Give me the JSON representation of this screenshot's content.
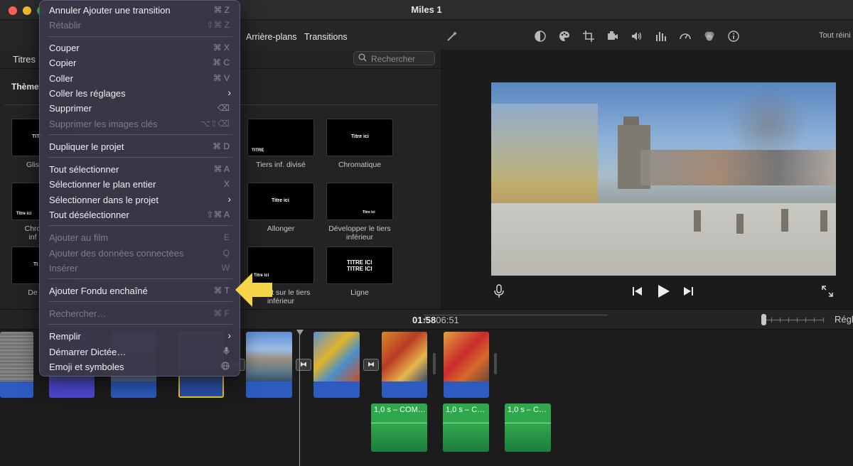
{
  "window": {
    "title": "Miles 1"
  },
  "toolbar": {
    "tabs": [
      "Arrière-plans",
      "Transitions"
    ],
    "reset_label": "Tout réini",
    "icons": [
      "magic-wand-icon",
      "color-balance-icon",
      "color-palette-icon",
      "crop-icon",
      "camera-icon",
      "volume-icon",
      "equalizer-icon",
      "speed-icon",
      "filter-icon",
      "info-icon"
    ]
  },
  "browser": {
    "tab": "Titres",
    "search_placeholder": "Rechercher",
    "themes_label": "Thème",
    "thumbnails": [
      {
        "thumb_text": "TITR",
        "label": "Glis"
      },
      {
        "thumb_text": "TITRE",
        "label": "Tiers inf. divisé"
      },
      {
        "thumb_text": "Titre ici",
        "label": "Chromatique"
      },
      {
        "thumb_text": "Titre ici",
        "label": "Chro\ninf"
      },
      {
        "thumb_text": "Titre ici",
        "label": "Allonger"
      },
      {
        "thumb_text": "Titre ici",
        "label": "Développer le tiers inférieur"
      },
      {
        "thumb_text": "TI",
        "label": "De"
      },
      {
        "thumb_text": "Titre ici",
        "label": "u point sur le tiers inférieur"
      },
      {
        "thumb_text": "TITRE ICI\nTITRE ICI",
        "label": "Ligne"
      }
    ]
  },
  "timeline": {
    "current_time": "01:58",
    "total_time": "06:51",
    "settings_label": "Régl",
    "audio_clips": [
      "1,0 s – COM…",
      "1,0 s – C…",
      "1,0 s – C…"
    ]
  },
  "menu": {
    "items": [
      {
        "label": "Annuler Ajouter une transition",
        "shortcut": "⌘ Z",
        "disabled": false
      },
      {
        "label": "Rétablir",
        "shortcut": "⇧⌘ Z",
        "disabled": true
      },
      {
        "label": "Couper",
        "shortcut": "⌘ X",
        "disabled": false
      },
      {
        "label": "Copier",
        "shortcut": "⌘ C",
        "disabled": false
      },
      {
        "label": "Coller",
        "shortcut": "⌘ V",
        "disabled": false
      },
      {
        "label": "Coller les réglages",
        "shortcut": "",
        "disabled": false
      },
      {
        "label": "Supprimer",
        "shortcut": "⌫",
        "disabled": false
      },
      {
        "label": "Supprimer les images clés",
        "shortcut": "⌥⇧⌫",
        "disabled": true
      },
      {
        "label": "Dupliquer le projet",
        "shortcut": "⌘ D",
        "disabled": false
      },
      {
        "label": "Tout sélectionner",
        "shortcut": "⌘ A",
        "disabled": false
      },
      {
        "label": "Sélectionner le plan entier",
        "shortcut": "X",
        "disabled": false
      },
      {
        "label": "Sélectionner dans le projet",
        "shortcut": "",
        "disabled": false
      },
      {
        "label": "Tout désélectionner",
        "shortcut": "⇧⌘ A",
        "disabled": false
      },
      {
        "label": "Ajouter au film",
        "shortcut": "E",
        "disabled": true
      },
      {
        "label": "Ajouter des données connectées",
        "shortcut": "Q",
        "disabled": true
      },
      {
        "label": "Insérer",
        "shortcut": "W",
        "disabled": true
      },
      {
        "label": "Ajouter Fondu enchaîné",
        "shortcut": "⌘ T",
        "disabled": false
      },
      {
        "label": "Rechercher…",
        "shortcut": "⌘ F",
        "disabled": true
      },
      {
        "label": "Remplir",
        "shortcut": "",
        "disabled": false
      },
      {
        "label": "Démarrer Dictée…",
        "shortcut": "🎙",
        "disabled": false
      },
      {
        "label": "Emoji et symboles",
        "shortcut": "🌐",
        "disabled": false
      }
    ]
  },
  "colors": {
    "accent_arrow": "#f5d547",
    "timeline_audio": "#2fa84d",
    "clip_audio": "#2d5bbf",
    "selected_clip_border": "#f0c419"
  }
}
